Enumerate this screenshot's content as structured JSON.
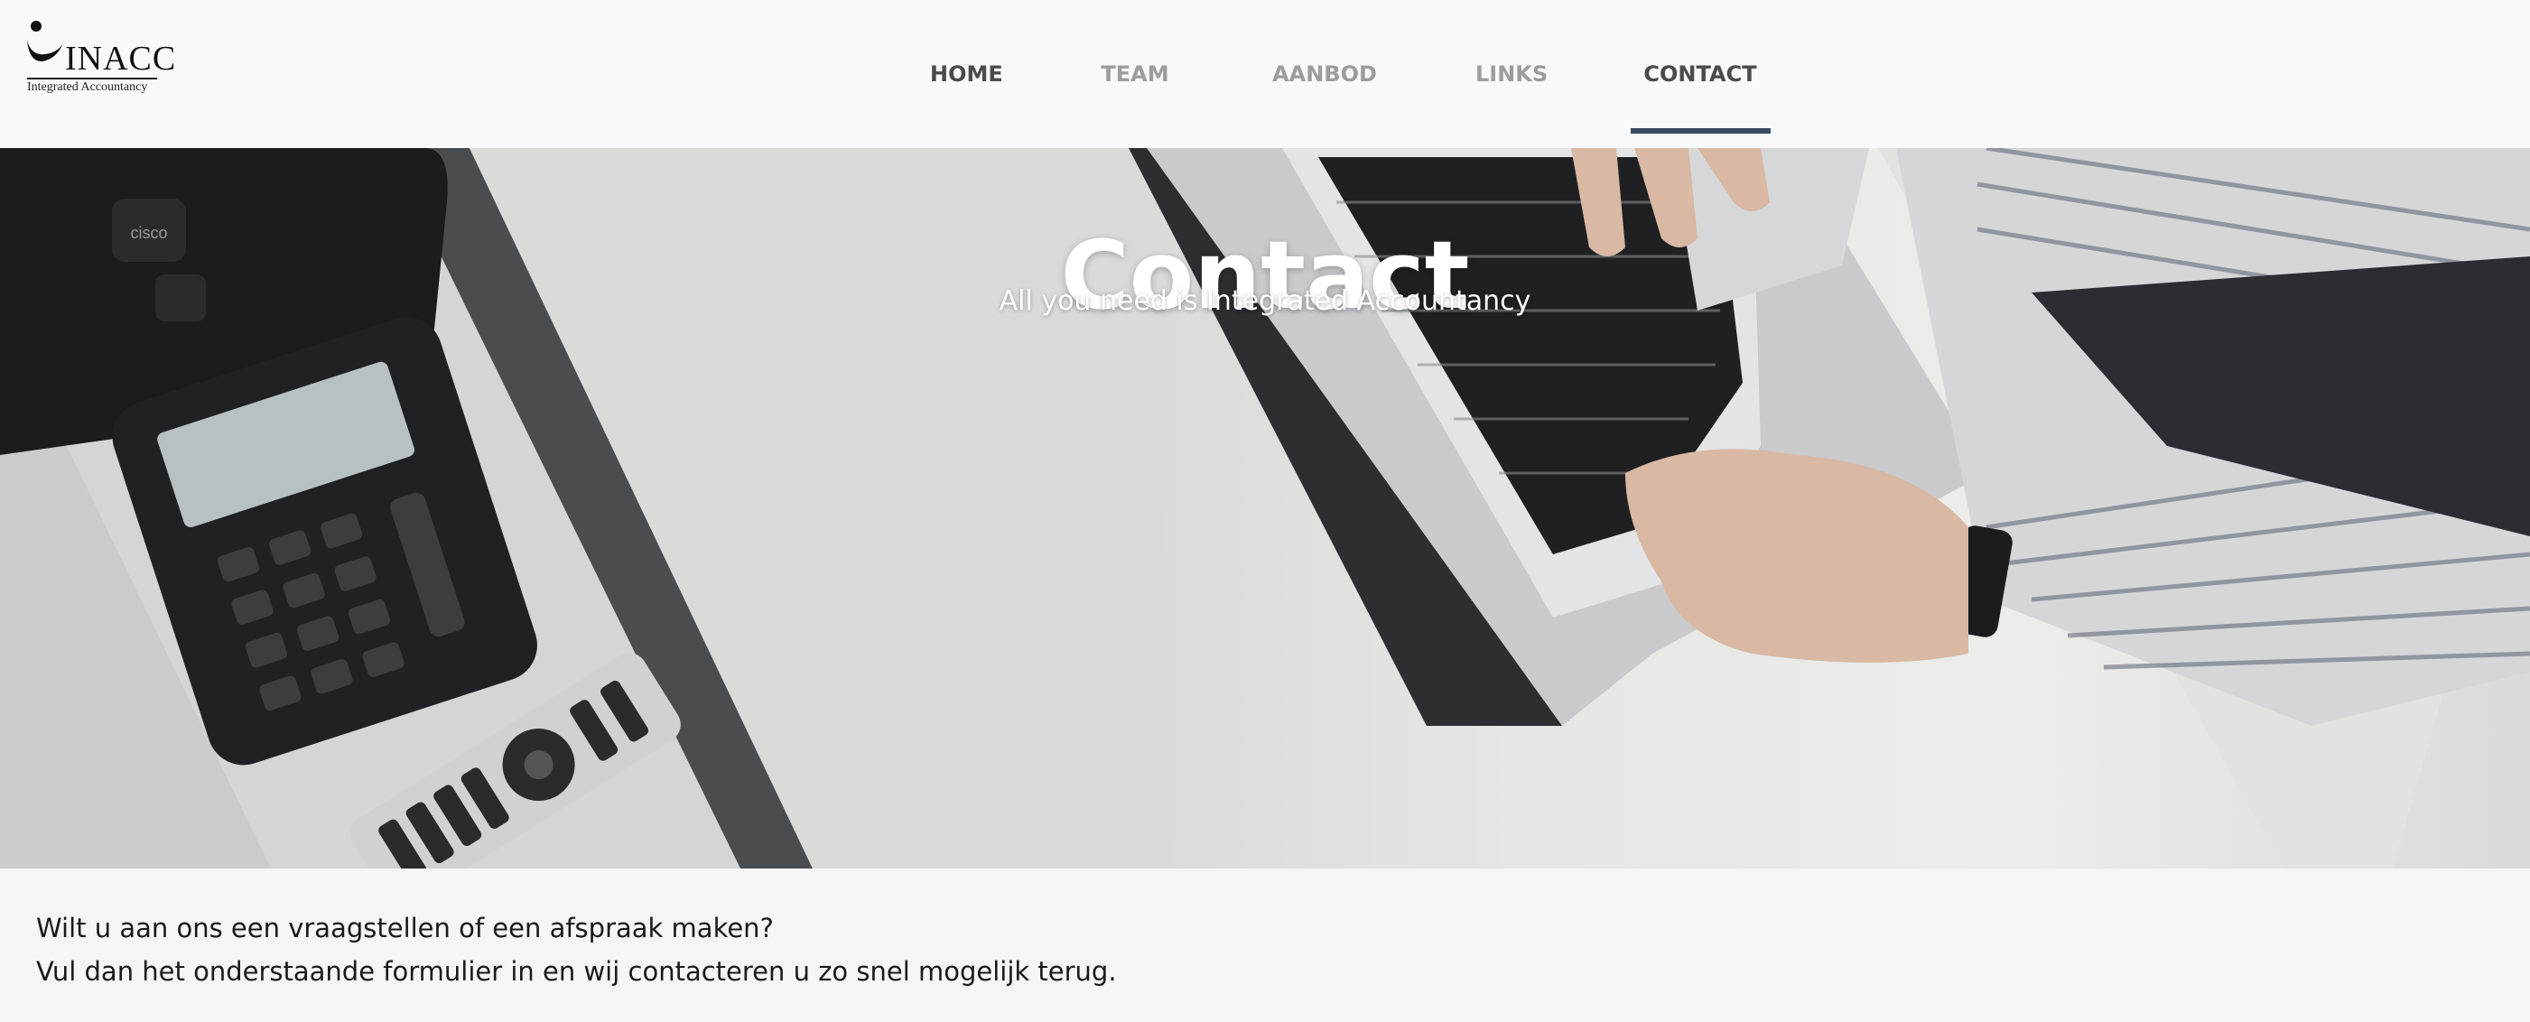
{
  "logo": {
    "name": "INACC",
    "tagline": "Integrated Accountancy"
  },
  "nav": {
    "items": [
      {
        "label": "HOME"
      },
      {
        "label": "TEAM"
      },
      {
        "label": "AANBOD"
      },
      {
        "label": "LINKS"
      },
      {
        "label": "CONTACT"
      }
    ],
    "active_index": 4
  },
  "hero": {
    "title": "Contact",
    "subtitle": "All you need is Integrated Accountancy",
    "phone_brand": "cisco"
  },
  "intro": {
    "line1": "Wilt u aan ons een vraagstellen of een afspraak maken?",
    "line2": "Vul dan het onderstaande formulier in en wij contacteren u zo snel mogelijk terug."
  },
  "colors": {
    "header_bg": "#f8f9fa",
    "nav_active": "#4b4b4b",
    "nav_inactive": "#9c9c9c",
    "nav_underline": "#3b4a60",
    "page_bg": "#f5f5f5"
  }
}
